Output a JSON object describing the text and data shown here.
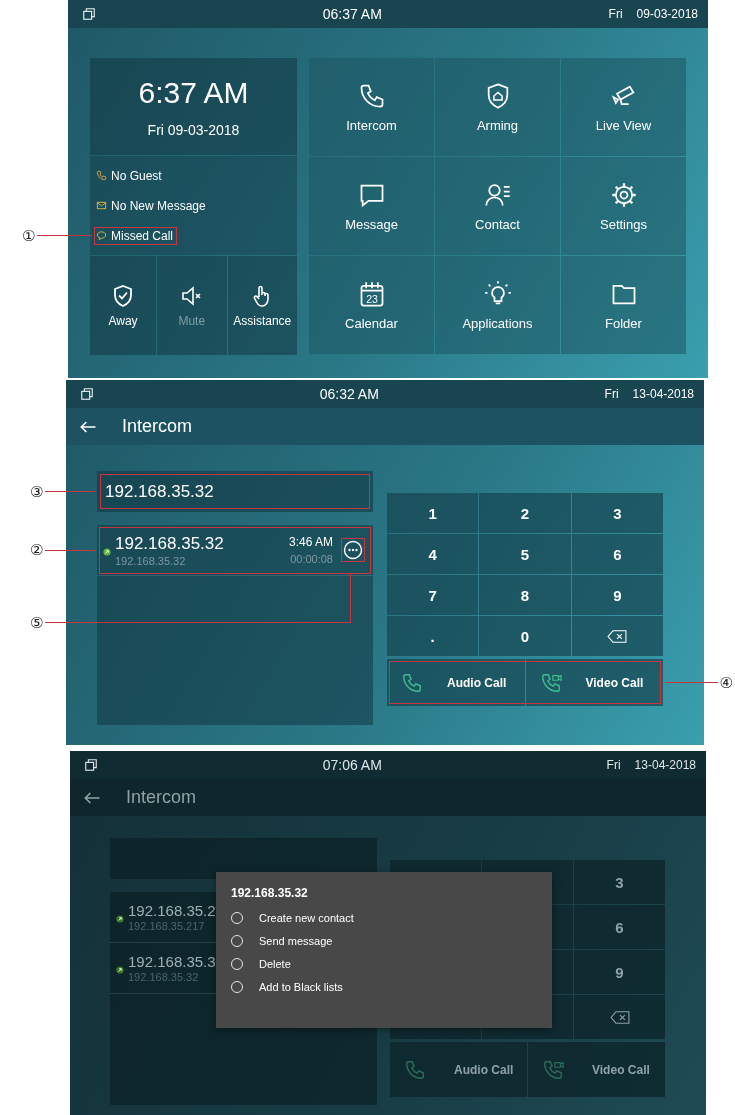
{
  "screens": [
    {
      "kind": "home",
      "status_bar": {
        "time": "06:37 AM",
        "day": "Fri",
        "date": "09-03-2018"
      },
      "clock": {
        "time": "6:37 AM",
        "date": "Fri 09-03-2018"
      },
      "notices": [
        {
          "kind": "guest",
          "text": "No Guest"
        },
        {
          "kind": "message",
          "text": "No New Message"
        },
        {
          "kind": "missed",
          "text": "Missed Call",
          "callout": "①"
        }
      ],
      "quick_buttons": [
        {
          "kind": "away",
          "label": "Away",
          "disabled": false
        },
        {
          "kind": "mute",
          "label": "Mute",
          "disabled": true
        },
        {
          "kind": "assistance",
          "label": "Assistance",
          "disabled": false
        }
      ],
      "tiles": [
        {
          "kind": "intercom",
          "label": "Intercom"
        },
        {
          "kind": "arming",
          "label": "Arming"
        },
        {
          "kind": "live_view",
          "label": "Live View"
        },
        {
          "kind": "message",
          "label": "Message"
        },
        {
          "kind": "contact",
          "label": "Contact"
        },
        {
          "kind": "settings",
          "label": "Settings"
        },
        {
          "kind": "calendar",
          "label": "Calendar",
          "icon_text": "23"
        },
        {
          "kind": "applications",
          "label": "Applications"
        },
        {
          "kind": "folder",
          "label": "Folder"
        }
      ]
    },
    {
      "kind": "intercom",
      "status_bar": {
        "time": "06:32 AM",
        "day": "Fri",
        "date": "13-04-2018"
      },
      "title": "Intercom",
      "input": {
        "value": "192.168.35.32",
        "callout": "③"
      },
      "records": [
        {
          "name": "192.168.35.32",
          "address": "192.168.35.32",
          "time": "3:46 AM",
          "duration": "00:00:08",
          "callout": "②",
          "more_callout": "⑤"
        }
      ],
      "keys": [
        {
          "kind": "digit",
          "label": "1"
        },
        {
          "kind": "digit",
          "label": "2"
        },
        {
          "kind": "digit",
          "label": "3"
        },
        {
          "kind": "digit",
          "label": "4"
        },
        {
          "kind": "digit",
          "label": "5"
        },
        {
          "kind": "digit",
          "label": "6"
        },
        {
          "kind": "digit",
          "label": "7"
        },
        {
          "kind": "digit",
          "label": "8"
        },
        {
          "kind": "digit",
          "label": "9"
        },
        {
          "kind": "digit",
          "label": "."
        },
        {
          "kind": "digit",
          "label": "0"
        },
        {
          "kind": "backspace"
        }
      ],
      "call_buttons": {
        "callout": "④",
        "items": [
          {
            "kind": "audio",
            "label": "Audio Call"
          },
          {
            "kind": "video",
            "label": "Video Call"
          }
        ]
      }
    },
    {
      "kind": "intercom_menu",
      "status_bar": {
        "time": "07:06 AM",
        "day": "Fri",
        "date": "13-04-2018"
      },
      "title": "Intercom",
      "records": [
        {
          "name": "192.168.35.2",
          "address": "192.168.35.217"
        },
        {
          "name": "192.168.35.3",
          "address": "192.168.35.32"
        }
      ],
      "keys": [
        {
          "kind": "digit",
          "label": "3"
        },
        {
          "kind": "digit",
          "label": "6"
        },
        {
          "kind": "digit",
          "label": "9"
        },
        {
          "kind": "backspace"
        }
      ],
      "call_buttons": {
        "items": [
          {
            "kind": "audio",
            "label": "Audio Call"
          },
          {
            "kind": "video",
            "label": "Video Call"
          }
        ]
      },
      "menu": {
        "title": "192.168.35.32",
        "options": [
          {
            "label": "Create new contact",
            "selected": false
          },
          {
            "label": "Send message",
            "selected": false
          },
          {
            "label": "Delete",
            "selected": false
          },
          {
            "label": "Add to Black lists",
            "selected": false
          }
        ]
      }
    }
  ]
}
